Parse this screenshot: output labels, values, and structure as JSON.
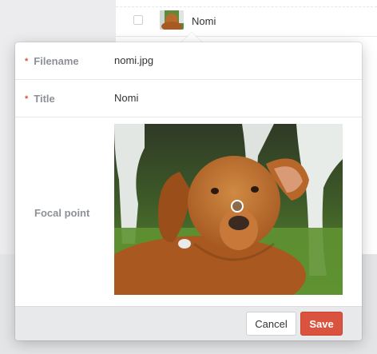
{
  "background": {
    "row": {
      "name": "Nomi"
    }
  },
  "modal": {
    "fields": {
      "filename": {
        "label": "Filename",
        "value": "nomi.jpg",
        "required_mark": "*"
      },
      "title": {
        "label": "Title",
        "value": "Nomi",
        "required_mark": "*"
      },
      "focal_point": {
        "label": "Focal point"
      }
    },
    "footer": {
      "cancel_label": "Cancel",
      "save_label": "Save"
    }
  },
  "colors": {
    "accent": "#d9533f",
    "label": "#8d9196",
    "footer_bg": "#e8e9eb"
  },
  "icons": {
    "required": "asterisk",
    "focal_marker": "circle-marker"
  }
}
